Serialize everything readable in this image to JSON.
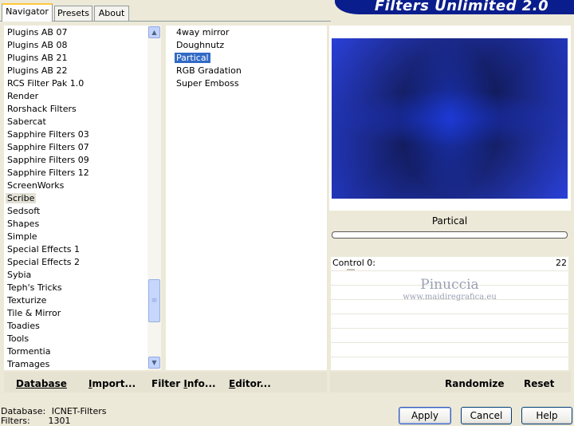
{
  "tabs": [
    "Navigator",
    "Presets",
    "About"
  ],
  "banner_title": "Filters Unlimited 2.0",
  "categories": [
    "Plugins AB 07",
    "Plugins AB 08",
    "Plugins AB 21",
    "Plugins AB 22",
    "RCS Filter Pak 1.0",
    "Render",
    "Rorshack Filters",
    "Sabercat",
    "Sapphire Filters 03",
    "Sapphire Filters 07",
    "Sapphire Filters 09",
    "Sapphire Filters 12",
    "ScreenWorks",
    "Scribe",
    "Sedsoft",
    "Shapes",
    "Simple",
    "Special Effects 1",
    "Special Effects 2",
    "Sybia",
    "Teph's Tricks",
    "Texturize",
    "Tile & Mirror",
    "Toadies",
    "Tools",
    "Tormentia",
    "Tramages"
  ],
  "selected_category": "Scribe",
  "filters": [
    "4way mirror",
    "Doughnutz",
    "Partical",
    "RGB Gradation",
    "Super Emboss"
  ],
  "selected_filter": "Partical",
  "preview_filter_name": "Partical",
  "progress_fraction": 0,
  "control": {
    "label": "Control 0:",
    "value": "22"
  },
  "watermark": {
    "name": "Pinuccia",
    "site": "www.maidiregrafica.eu"
  },
  "toolbar": {
    "database": "Database",
    "import_u": "I",
    "import_rest": "mport...",
    "filter_info_a": "Filter ",
    "filter_info_u": "I",
    "filter_info_b": "nfo...",
    "editor_u": "E",
    "editor_rest": "ditor...",
    "randomize": "Randomize",
    "reset": "Reset"
  },
  "status": {
    "database_label": "Database:",
    "database_value": "ICNET-Filters",
    "filters_label": "Filters:",
    "filters_value": "1301"
  },
  "buttons": {
    "apply": "Apply",
    "cancel": "Cancel",
    "help": "Help"
  },
  "colors": {
    "selection_blue": "#316ac5",
    "banner_blue": "#0a1d8c",
    "tab_highlight": "#ffc83c"
  },
  "icons": {
    "scroll_up": "chevron-up-icon",
    "scroll_down": "chevron-down-icon",
    "thumb_grip": "grip-icon"
  }
}
